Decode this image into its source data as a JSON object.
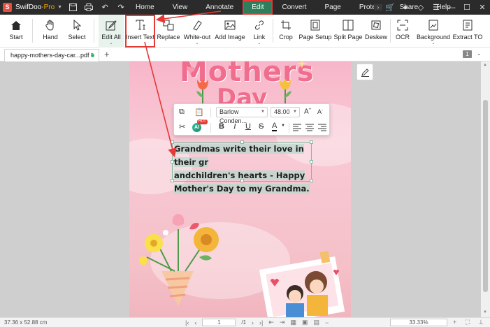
{
  "app": {
    "name": "SwifDoo",
    "edition": "-Pro"
  },
  "menu": [
    "Home",
    "View",
    "Annotate",
    "Edit",
    "Convert",
    "Page",
    "Protect",
    "Share",
    "Help"
  ],
  "active_menu": "Edit",
  "ribbon": {
    "start": "Start",
    "hand": "Hand",
    "select": "Select",
    "edit_all": "Edit All",
    "insert_text": "Insert Text",
    "replace": "Replace",
    "white_out": "White-out",
    "add_image": "Add Image",
    "link": "Link",
    "crop": "Crop",
    "page_setup": "Page Setup",
    "split_page": "Split Page",
    "deskew": "Deskew",
    "ocr": "OCR",
    "background": "Background",
    "extract": "Extract TO"
  },
  "tab": {
    "filename": "happy-mothers-day-car...pdf *",
    "page_count": "1"
  },
  "document": {
    "title_line1": "Mothers",
    "title_line2": "Day",
    "textbox_lines": [
      "Grandmas write their love in their gr",
      "andchildren's hearts - Happy",
      "Mother's Day to my Grandma."
    ]
  },
  "text_toolbar": {
    "font": "Barlow Conden...",
    "size": "48.00",
    "ai": "AI",
    "hot": "HOT"
  },
  "status": {
    "dimensions": "37.36 x 52.88 cm",
    "current_page": "1",
    "total_pages": "/1",
    "zoom": "33.33%"
  },
  "colors": {
    "accent": "#2e7d5b",
    "annotation": "#e53935",
    "title_bar": "#2b2b2b"
  }
}
